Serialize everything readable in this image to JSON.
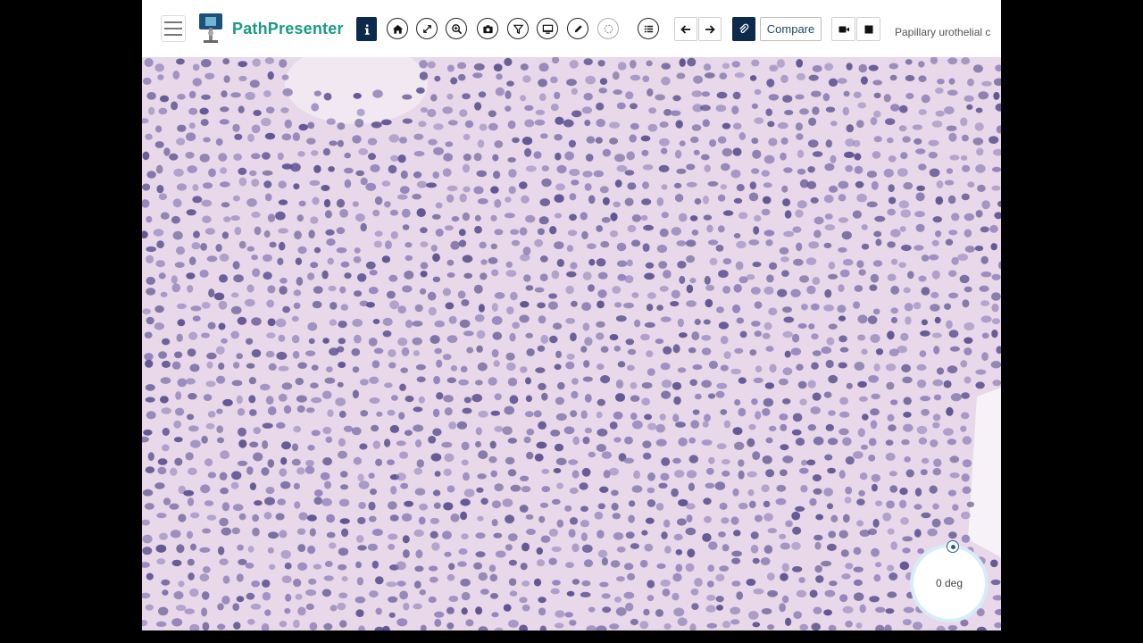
{
  "app": {
    "brand": "PathPresenter",
    "slide_title": "Papillary urothelial c"
  },
  "toolbar": {
    "compare_label": "Compare",
    "buttons": [
      {
        "name": "info-icon"
      },
      {
        "name": "home-icon"
      },
      {
        "name": "fullscreen-icon"
      },
      {
        "name": "zoom-icon"
      },
      {
        "name": "camera-icon"
      },
      {
        "name": "filter-icon"
      },
      {
        "name": "monitor-icon"
      },
      {
        "name": "pencil-icon"
      },
      {
        "name": "lasso-icon"
      },
      {
        "name": "list-icon"
      },
      {
        "name": "arrow-left-icon"
      },
      {
        "name": "arrow-right-icon"
      },
      {
        "name": "paperclip-icon"
      },
      {
        "name": "video-icon"
      },
      {
        "name": "stop-icon"
      }
    ]
  },
  "viewer": {
    "rotation_label": "0 deg",
    "colors": {
      "background": "#e7d7e7",
      "nucleus_dark": "#5a4f8e",
      "nucleus_light": "#8f7fb8"
    }
  }
}
